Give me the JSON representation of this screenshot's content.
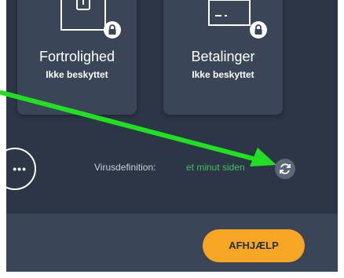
{
  "cards": [
    {
      "title": "Fortrolighed",
      "status": "Ikke beskyttet",
      "icon": "document-icon"
    },
    {
      "title": "Betalinger",
      "status": "Ikke beskyttet",
      "icon": "credit-card-icon"
    }
  ],
  "more_button": {
    "label": "•••"
  },
  "virus_definition": {
    "label": "Virusdefinition:",
    "value": "et minut siden"
  },
  "refresh_icon": "refresh-icon",
  "fix_button": {
    "label": "AFHJÆLP"
  },
  "colors": {
    "background": "#2d3646",
    "card": "#3a4557",
    "accent_orange": "#f6a623",
    "status_green": "#3ec45a",
    "annotation_arrow": "#21e021"
  }
}
